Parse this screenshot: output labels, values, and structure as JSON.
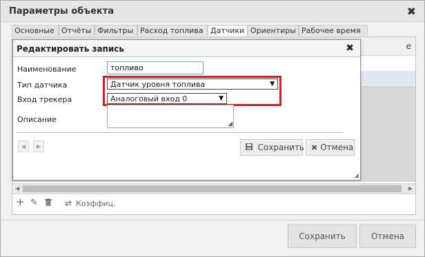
{
  "window": {
    "title": "Параметры объекта",
    "close_glyph": "✖"
  },
  "tabs": [
    {
      "label": "Основные"
    },
    {
      "label": "Отчёты"
    },
    {
      "label": "Фильтры"
    },
    {
      "label": "Расход топлива"
    },
    {
      "label": "Датчики",
      "active": true
    },
    {
      "label": "Ориентиры"
    },
    {
      "label": "Рабочее время"
    }
  ],
  "grid": {
    "header_partial": "е",
    "toolbar": {
      "add_icon": "plus-icon",
      "edit_icon": "pencil-icon",
      "delete_icon": "trash-icon",
      "coef_icon": "arrows-icon",
      "coef_label": "Коэффиц."
    }
  },
  "modal": {
    "title": "Редактировать запись",
    "close_glyph": "✖",
    "fields": {
      "name_label": "Наименование",
      "name_value": "топливо",
      "sensor_type_label": "Тип датчика",
      "sensor_type_value": "Датчик уровня топлива",
      "tracker_input_label": "Вход трекера",
      "tracker_input_value": "Аналоговый вход 0",
      "description_label": "Описание"
    },
    "buttons": {
      "save_label": "Сохранить",
      "cancel_label": "Отмена"
    },
    "highlight_color": "#cc1f2a"
  },
  "footer": {
    "save_label": "Сохранить",
    "cancel_label": "Отмена"
  }
}
